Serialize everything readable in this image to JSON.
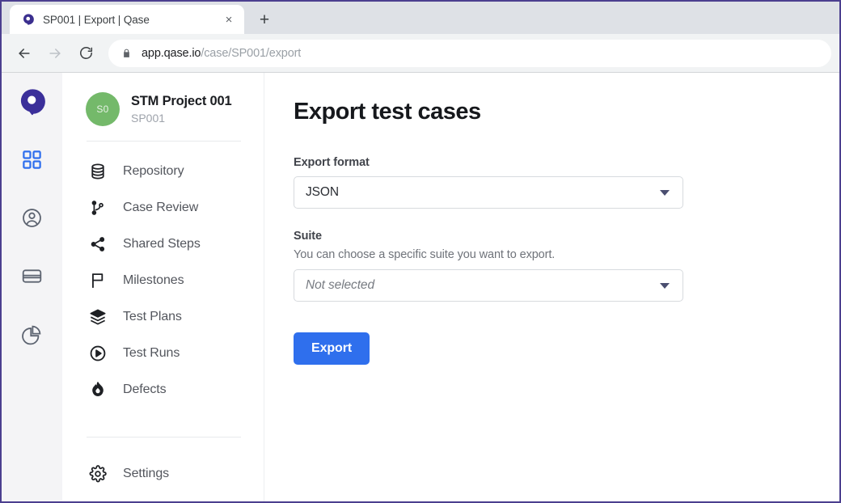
{
  "browser": {
    "tab": {
      "title": "SP001 | Export | Qase",
      "favicon_icon": "qase-logo-icon",
      "close_label": "×"
    },
    "new_tab_label": "+",
    "nav": {
      "back_icon": "arrow-left-icon",
      "forward_icon": "arrow-right-icon",
      "reload_icon": "reload-icon"
    },
    "omnibox": {
      "lock_icon": "lock-icon",
      "url_domain": "app.qase.io",
      "url_path": "/case/SP001/export",
      "full_url": "app.qase.io/case/SP001/export"
    }
  },
  "icon_rail": {
    "logo_icon": "qase-logo-icon",
    "items": [
      {
        "name": "projects",
        "icon": "grid-icon",
        "active": true
      },
      {
        "name": "users",
        "icon": "user-circle-icon",
        "active": false
      },
      {
        "name": "billing",
        "icon": "card-icon",
        "active": false
      },
      {
        "name": "reports",
        "icon": "pie-chart-icon",
        "active": false
      }
    ]
  },
  "sidebar": {
    "project": {
      "avatar_initials": "S0",
      "avatar_color": "#74b96a",
      "title": "STM Project 001",
      "code": "SP001"
    },
    "items": [
      {
        "label": "Repository",
        "icon": "database-icon"
      },
      {
        "label": "Case Review",
        "icon": "git-branch-icon"
      },
      {
        "label": "Shared Steps",
        "icon": "share-nodes-icon"
      },
      {
        "label": "Milestones",
        "icon": "flag-icon"
      },
      {
        "label": "Test Plans",
        "icon": "layers-icon"
      },
      {
        "label": "Test Runs",
        "icon": "play-circle-icon"
      },
      {
        "label": "Defects",
        "icon": "flame-icon"
      }
    ],
    "settings": {
      "label": "Settings",
      "icon": "gear-icon"
    }
  },
  "main": {
    "page_title": "Export test cases",
    "export_format": {
      "label": "Export format",
      "value": "JSON",
      "caret_icon": "chevron-down-icon"
    },
    "suite": {
      "label": "Suite",
      "help": "You can choose a specific suite you want to export.",
      "value": "Not selected",
      "is_placeholder": true,
      "caret_icon": "chevron-down-icon"
    },
    "export_button": {
      "label": "Export",
      "color": "#2f6fed"
    }
  }
}
